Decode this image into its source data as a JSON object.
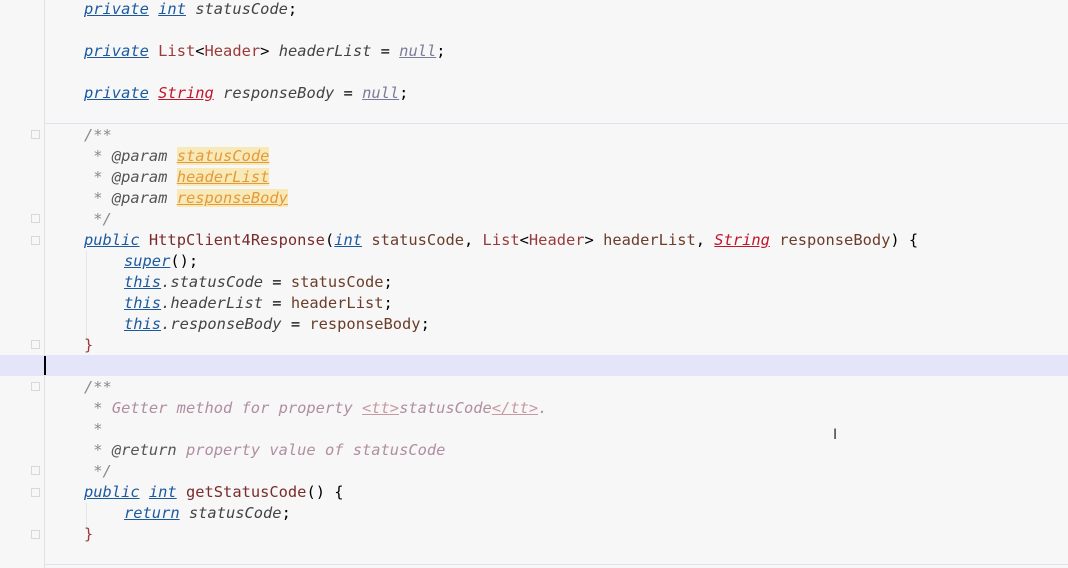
{
  "editor": {
    "lines": {
      "l1": {
        "kw": "private",
        "t1": " ",
        "kw2": "int",
        "t2": " ",
        "f": "statusCode",
        "t3": ";"
      },
      "l2": {
        "kw": "private",
        "t1": " ",
        "typ": "List",
        "p1": "<",
        "typ2": "Header",
        "p2": ">",
        "t2": " ",
        "f": "headerList",
        "t3": " = ",
        "nul": "null",
        "t4": ";"
      },
      "l3": {
        "kw": "private",
        "t1": " ",
        "str": "String",
        "t2": " ",
        "f": "responseBody",
        "t3": " = ",
        "nul": "null",
        "t4": ";"
      },
      "d1": {
        "c": "/**"
      },
      "d2": {
        "c": " * ",
        "tag": "@param",
        "sp": " ",
        "pn": "statusCode"
      },
      "d3": {
        "c": " * ",
        "tag": "@param",
        "sp": " ",
        "pn": "headerList"
      },
      "d4": {
        "c": " * ",
        "tag": "@param",
        "sp": " ",
        "pn": "responseBody"
      },
      "d5": {
        "c": " */"
      },
      "c1": {
        "kw": "public",
        "sp": " ",
        "mth": "HttpClient4Response",
        "p1": "(",
        "kw2": "int",
        "sp2": " ",
        "v1": "statusCode",
        "p2": ", ",
        "typ": "List",
        "p3": "<",
        "typ2": "Header",
        "p4": ">",
        "sp3": " ",
        "v2": "headerList",
        "p5": ", ",
        "str": "String",
        "sp4": " ",
        "v3": "responseBody",
        "p6": ") {"
      },
      "c2": {
        "kw": "super",
        "p": "();"
      },
      "c3": {
        "kw": "this",
        "f": ".statusCode",
        "eq": " = ",
        "v": "statusCode",
        "s": ";"
      },
      "c4": {
        "kw": "this",
        "f": ".headerList",
        "eq": " = ",
        "v": "headerList",
        "s": ";"
      },
      "c5": {
        "kw": "this",
        "f": ".responseBody",
        "eq": " = ",
        "v": "responseBody",
        "s": ";"
      },
      "c6": {
        "b": "}"
      },
      "e1": {
        "c": "/**"
      },
      "e2": {
        "c": " * ",
        "d": "Getter method for property ",
        "ht1": "<tt>",
        "d2": "statusCode",
        "ht2": "</tt>",
        "d3": "."
      },
      "e3": {
        "c": " *"
      },
      "e4": {
        "c": " * ",
        "tag": "@return",
        "d": " property value of statusCode"
      },
      "e5": {
        "c": " */"
      },
      "g1": {
        "kw": "public",
        "sp": " ",
        "kw2": "int",
        "sp2": " ",
        "mth": "getStatusCode",
        "p": "() {"
      },
      "g2": {
        "kw": "return",
        "sp": " ",
        "f": "statusCode",
        "s": ";"
      },
      "g3": {
        "b": "}"
      }
    }
  }
}
